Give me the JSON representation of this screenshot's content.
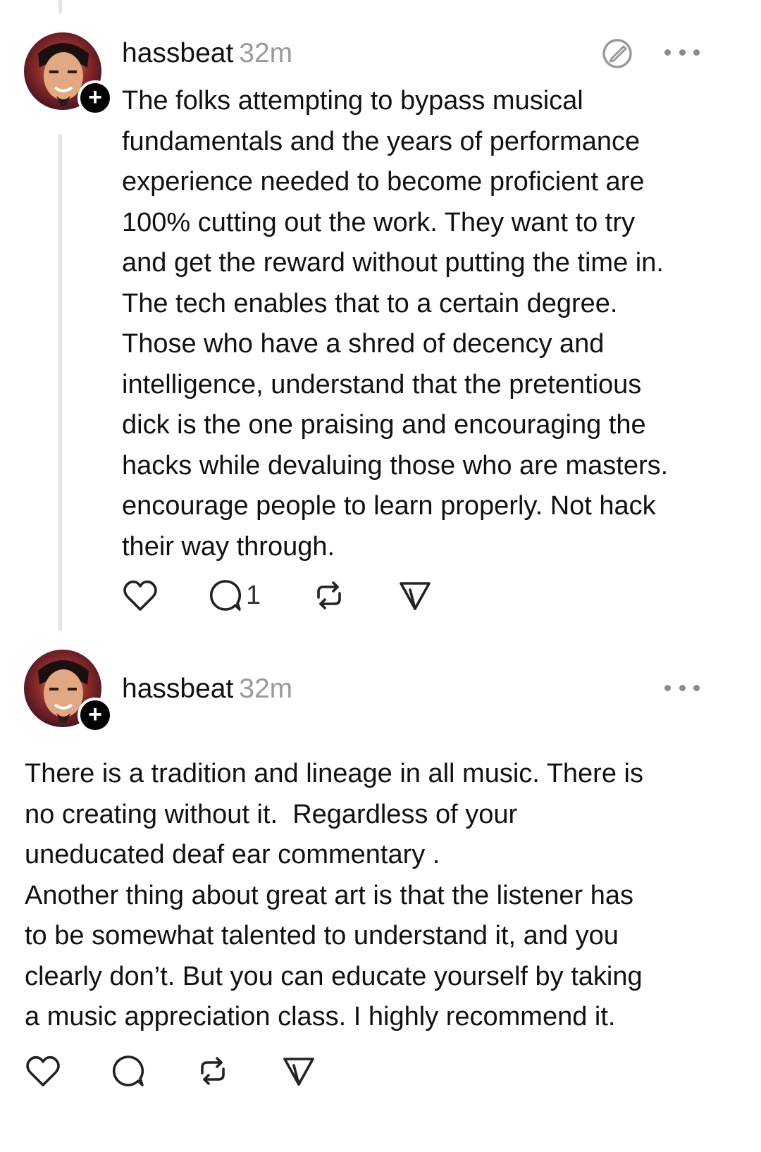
{
  "posts": [
    {
      "username": "hassbeat",
      "time": "32m",
      "text": "The folks attempting to bypass musical\nfundamentals and the years of performance\nexperience needed to become proficient are\n100% cutting out the work. They want to try\nand get the reward without putting the time in.\nThe tech enables that to a certain degree.\nThose who have a shred of decency and\nintelligence, understand that the pretentious\ndick is the one praising and encouraging the\nhacks while devaluing those who are masters.\nencourage people to learn properly. Not hack\ntheir way through.",
      "reply_count": "1",
      "icons": [
        "like-heart-icon",
        "reply-bubble-icon",
        "repost-icon",
        "share-send-icon",
        "edit-icon",
        "more-dots-icon"
      ]
    },
    {
      "username": "hassbeat",
      "time": "32m",
      "text": "There is a tradition and lineage in all music. There is\nno creating without it.  Regardless of your\nuneducated deaf ear commentary .\nAnother thing about great art is that the listener has\nto be somewhat talented to understand it, and you\nclearly don’t. But you can educate yourself by taking\na music appreciation class. I highly recommend it.",
      "icons": [
        "like-heart-icon",
        "reply-bubble-icon",
        "repost-icon",
        "share-send-icon",
        "more-dots-icon"
      ]
    }
  ],
  "follow_badge_symbol": "+",
  "colors": {
    "timestamp": "#9a9a9a",
    "thread_line": "#e3e3e3",
    "text": "#111111",
    "icon": "#222222"
  }
}
